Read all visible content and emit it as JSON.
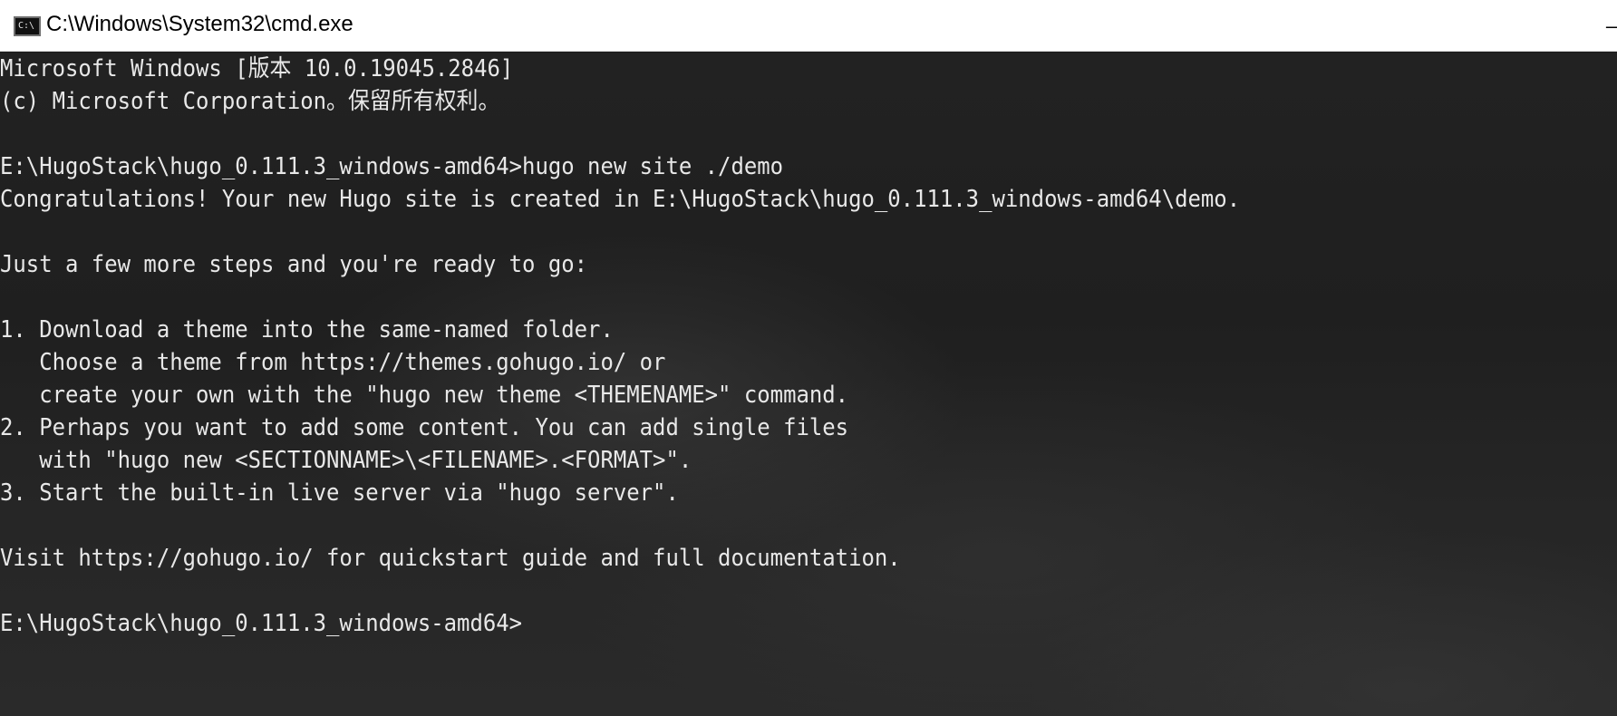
{
  "window": {
    "title": "C:\\Windows\\System32\\cmd.exe",
    "app_icon_label": "C:\\",
    "minimize_glyph": "–"
  },
  "console": {
    "lines": [
      "Microsoft Windows [版本 10.0.19045.2846]",
      "(c) Microsoft Corporation。保留所有权利。",
      "",
      "E:\\HugoStack\\hugo_0.111.3_windows-amd64>hugo new site ./demo",
      "Congratulations! Your new Hugo site is created in E:\\HugoStack\\hugo_0.111.3_windows-amd64\\demo.",
      "",
      "Just a few more steps and you're ready to go:",
      "",
      "1. Download a theme into the same-named folder.",
      "   Choose a theme from https://themes.gohugo.io/ or",
      "   create your own with the \"hugo new theme <THEMENAME>\" command.",
      "2. Perhaps you want to add some content. You can add single files",
      "   with \"hugo new <SECTIONNAME>\\<FILENAME>.<FORMAT>\".",
      "3. Start the built-in live server via \"hugo server\".",
      "",
      "Visit https://gohugo.io/ for quickstart guide and full documentation.",
      "",
      "E:\\HugoStack\\hugo_0.111.3_windows-amd64>"
    ]
  }
}
